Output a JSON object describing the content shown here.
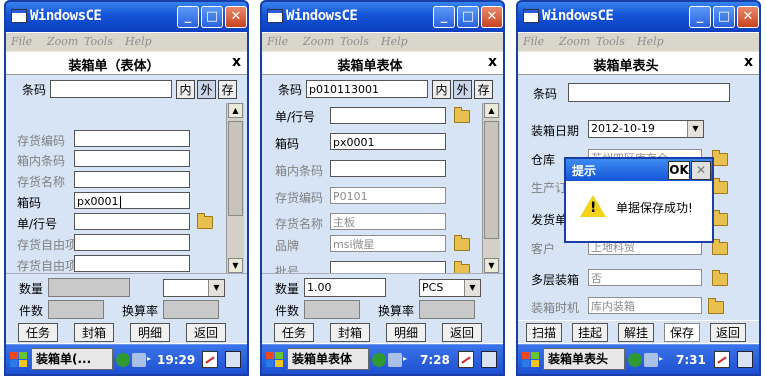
{
  "os_title": "WindowsCE",
  "menu": [
    "File",
    "Zoom",
    "Tools",
    "Help"
  ],
  "window1": {
    "app_title": "装箱单（表体）",
    "close": "x",
    "barcode_label": "条码",
    "barcode_value": "",
    "mode_buttons": [
      "内",
      "外",
      "存"
    ],
    "fields": [
      {
        "label": "存货编码",
        "value": ""
      },
      {
        "label": "箱内条码",
        "value": ""
      },
      {
        "label": "存货名称",
        "value": ""
      },
      {
        "label": "箱码",
        "value": "px0001"
      },
      {
        "label": "单/行号",
        "value": ""
      },
      {
        "label": "存货自由项",
        "value": ""
      },
      {
        "label": "存货自由项",
        "value": ""
      }
    ],
    "qty_label": "数量",
    "pieces_label": "件数",
    "rate_label": "换算率",
    "buttons": [
      "任务",
      "封箱",
      "明细",
      "返回"
    ],
    "task": "装箱单(...",
    "time": "19:29"
  },
  "window2": {
    "app_title": "装箱单表体",
    "close": "x",
    "barcode_label": "条码",
    "barcode_value": "p010113001",
    "mode_buttons": [
      "内",
      "外",
      "存"
    ],
    "fields": [
      {
        "label": "单/行号",
        "value": ""
      },
      {
        "label": "箱码",
        "value": "px0001"
      },
      {
        "label": "箱内条码",
        "value": ""
      },
      {
        "label": "存货编码",
        "value": "P0101"
      },
      {
        "label": "存货名称",
        "value": "主板"
      },
      {
        "label": "品牌",
        "value": "msi微星"
      },
      {
        "label": "批号",
        "value": ""
      }
    ],
    "qty_label": "数量",
    "qty_value": "1.00",
    "unit_value": "PCS",
    "pieces_label": "件数",
    "rate_label": "换算率",
    "buttons": [
      "任务",
      "封箱",
      "明细",
      "返回"
    ],
    "task": "装箱单表体",
    "time": "7:28"
  },
  "window3": {
    "app_title": "装箱单表头",
    "close": "x",
    "fields": [
      {
        "label": "条码",
        "value": ""
      },
      {
        "label": "装箱日期",
        "value": "2012-10-19"
      },
      {
        "label": "仓库",
        "value": "苏州四区库存仓"
      },
      {
        "label": "生产订",
        "value": ""
      },
      {
        "label": "发货单",
        "value": ""
      },
      {
        "label": "客户",
        "value": "上地科贸"
      },
      {
        "label": "多层装箱",
        "value": "否"
      },
      {
        "label": "装箱时机",
        "value": "库内装箱"
      }
    ],
    "buttons": [
      "扫描",
      "挂起",
      "解挂",
      "保存",
      "返回"
    ],
    "dialog": {
      "title": "提示",
      "ok": "OK",
      "close": "✕",
      "message": "单据保存成功!"
    },
    "task": "装箱单表头",
    "time": "7:31"
  },
  "colors": {
    "titlebar": "#1554d8",
    "taskbar": "#2a5ad8",
    "form_bg": "#d6e4f6"
  }
}
